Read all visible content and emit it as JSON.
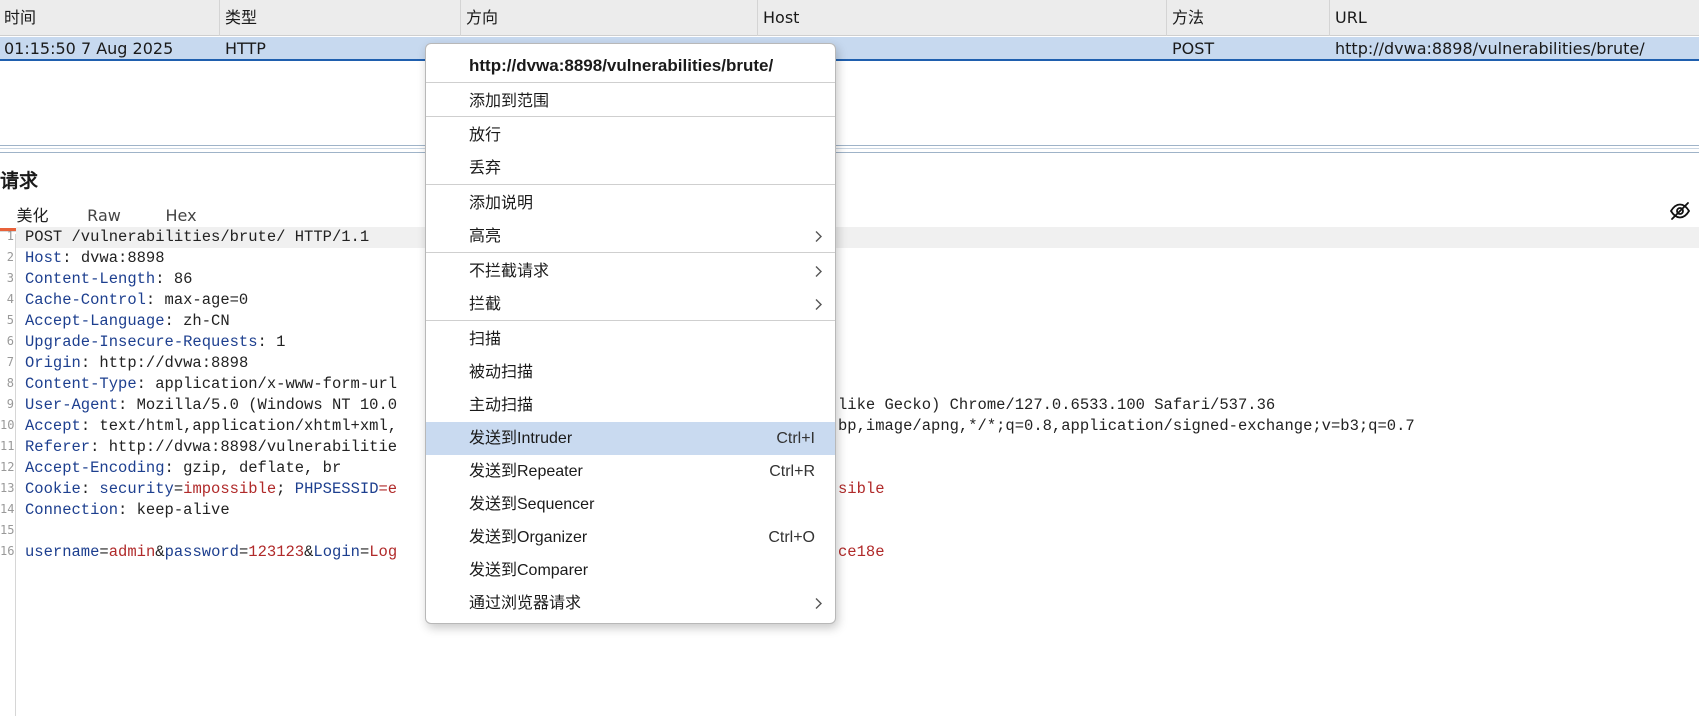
{
  "table": {
    "headers": [
      "时间",
      "类型",
      "方向",
      "Host",
      "方法",
      "URL"
    ],
    "row": [
      "01:15:50 7 Aug 2025",
      "HTTP",
      "",
      "",
      "POST",
      "http://dvwa:8898/vulnerabilities/brute/"
    ]
  },
  "request": {
    "title": "请求",
    "tabs": [
      "美化",
      "Raw",
      "Hex"
    ],
    "active_tab": "美化",
    "line_numbers": [
      "1",
      "2",
      "3",
      "4",
      "5",
      "6",
      "7",
      "8",
      "9",
      "10",
      "11",
      "12",
      "13",
      "14",
      "15",
      "16"
    ],
    "lines": {
      "l1": "POST /vulnerabilities/brute/ HTTP/1.1",
      "l2k": "Host",
      "l2v": ": dvwa:8898",
      "l3k": "Content-Length",
      "l3v": ": 86",
      "l4k": "Cache-Control",
      "l4v": ": max-age=0",
      "l5k": "Accept-Language",
      "l5v": ": zh-CN",
      "l6k": "Upgrade-Insecure-Requests",
      "l6v": ": 1",
      "l7k": "Origin",
      "l7v": ": http://dvwa:8898",
      "l8k": "Content-Type",
      "l8v": ": application/x-www-form-url",
      "l9k": "User-Agent",
      "l9v": ": Mozilla/5.0 (Windows NT 10.0",
      "l9r": "like Gecko) Chrome/127.0.6533.100 Safari/537.36",
      "l10k": "Accept",
      "l10v": ": text/html,application/xhtml+xml,",
      "l10r": "bp,image/apng,*/*;q=0.8,application/signed-exchange;v=b3;q=0.7",
      "l11k": "Referer",
      "l11v": ": http://dvwa:8898/vulnerabilitie",
      "l12k": "Accept-Encoding",
      "l12v": ": gzip, deflate, br",
      "l13k": "Cookie",
      "l13a": ": ",
      "l13b": "security",
      "l13c": "=",
      "l13d": "impossible",
      "l13e": "; ",
      "l13f": "PHPSESSID",
      "l13g": "=e",
      "l13r": "sible",
      "l14k": "Connection",
      "l14v": ": keep-alive",
      "l16a": "username",
      "l16b": "=",
      "l16c": "admin",
      "l16d": "&",
      "l16e": "password",
      "l16f": "=",
      "l16g": "123123",
      "l16h": "&",
      "l16i": "Login",
      "l16j": "=",
      "l16k": "Log",
      "l16r": "ce18e"
    }
  },
  "context_menu": {
    "header_url": "http://dvwa:8898/vulnerabilities/brute/",
    "items": [
      {
        "label": "添加到范围"
      },
      {
        "label": "放行"
      },
      {
        "label": "丢弃"
      },
      {
        "label": "添加说明"
      },
      {
        "label": "高亮"
      },
      {
        "label": "不拦截请求"
      },
      {
        "label": "拦截"
      },
      {
        "label": "扫描"
      },
      {
        "label": "被动扫描"
      },
      {
        "label": "主动扫描"
      },
      {
        "label": "发送到Intruder",
        "shortcut": "Ctrl+I"
      },
      {
        "label": "发送到Repeater",
        "shortcut": "Ctrl+R"
      },
      {
        "label": "发送到Sequencer"
      },
      {
        "label": "发送到Organizer",
        "shortcut": "Ctrl+O"
      },
      {
        "label": "发送到Comparer"
      },
      {
        "label": "通过浏览器请求"
      }
    ],
    "highlighted_item": "发送到Intruder"
  },
  "colors": {
    "selected_row": "#c7d9ef",
    "menu_highlight": "#c9daf0",
    "active_tab_underline": "#e8623a",
    "header_key": "#1d3f8f",
    "param_value": "#b02a2a"
  },
  "icons": {
    "visibility": "eye-off-icon",
    "submenu": "chevron-right-icon"
  }
}
